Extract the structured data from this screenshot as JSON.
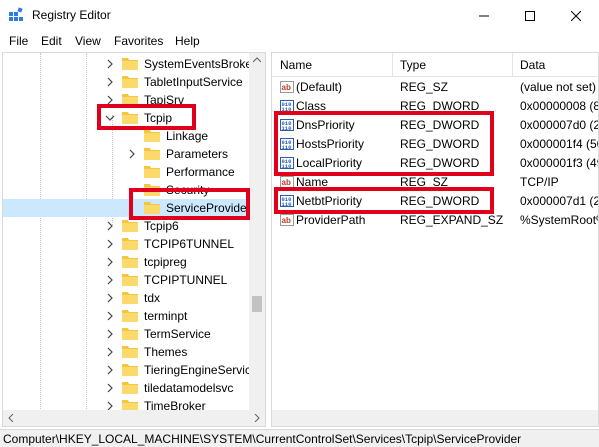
{
  "window": {
    "title": "Registry Editor"
  },
  "menu": [
    "File",
    "Edit",
    "View",
    "Favorites",
    "Help"
  ],
  "tree": {
    "items": [
      {
        "label": "SystemEventsBroker",
        "expander": true
      },
      {
        "label": "TabletInputService",
        "expander": true
      },
      {
        "label": "TapiSrv",
        "expander": true
      },
      {
        "label": "Tcpip",
        "expander": "open"
      },
      {
        "label": "Linkage",
        "expander": false
      },
      {
        "label": "Parameters",
        "expander": true
      },
      {
        "label": "Performance",
        "expander": false
      },
      {
        "label": "Security",
        "expander": false
      },
      {
        "label": "ServiceProvider",
        "expander": false,
        "selected": true
      },
      {
        "label": "Tcpip6",
        "expander": true
      },
      {
        "label": "TCPIP6TUNNEL",
        "expander": true
      },
      {
        "label": "tcpipreg",
        "expander": true
      },
      {
        "label": "TCPIPTUNNEL",
        "expander": true
      },
      {
        "label": "tdx",
        "expander": true
      },
      {
        "label": "terminpt",
        "expander": true
      },
      {
        "label": "TermService",
        "expander": true
      },
      {
        "label": "Themes",
        "expander": true
      },
      {
        "label": "TieringEngineService",
        "expander": true
      },
      {
        "label": "tiledatamodelsvc",
        "expander": true
      },
      {
        "label": "TimeBroker",
        "expander": true
      }
    ]
  },
  "list": {
    "columns": [
      "Name",
      "Type",
      "Data"
    ],
    "rows": [
      {
        "name": "(Default)",
        "type": "REG_SZ",
        "data": "(value not set)",
        "icon": "string-value-icon"
      },
      {
        "name": "Class",
        "type": "REG_DWORD",
        "data": "0x00000008 (8)",
        "icon": "dword-value-icon"
      },
      {
        "name": "DnsPriority",
        "type": "REG_DWORD",
        "data": "0x000007d0 (20",
        "icon": "dword-value-icon"
      },
      {
        "name": "HostsPriority",
        "type": "REG_DWORD",
        "data": "0x000001f4 (50",
        "icon": "dword-value-icon"
      },
      {
        "name": "LocalPriority",
        "type": "REG_DWORD",
        "data": "0x000001f3 (49",
        "icon": "dword-value-icon"
      },
      {
        "name": "Name",
        "type": "REG_SZ",
        "data": "TCP/IP",
        "icon": "string-value-icon"
      },
      {
        "name": "NetbtPriority",
        "type": "REG_DWORD",
        "data": "0x000007d1 (20",
        "icon": "dword-value-icon"
      },
      {
        "name": "ProviderPath",
        "type": "REG_EXPAND_SZ",
        "data": "%SystemRoot%",
        "icon": "string-value-icon"
      }
    ]
  },
  "status": "Computer\\HKEY_LOCAL_MACHINE\\SYSTEM\\CurrentControlSet\\Services\\Tcpip\\ServiceProvider",
  "colors": {
    "highlight": "#e0001b",
    "folder": "#f5c542",
    "selection": "#cce8ff"
  }
}
